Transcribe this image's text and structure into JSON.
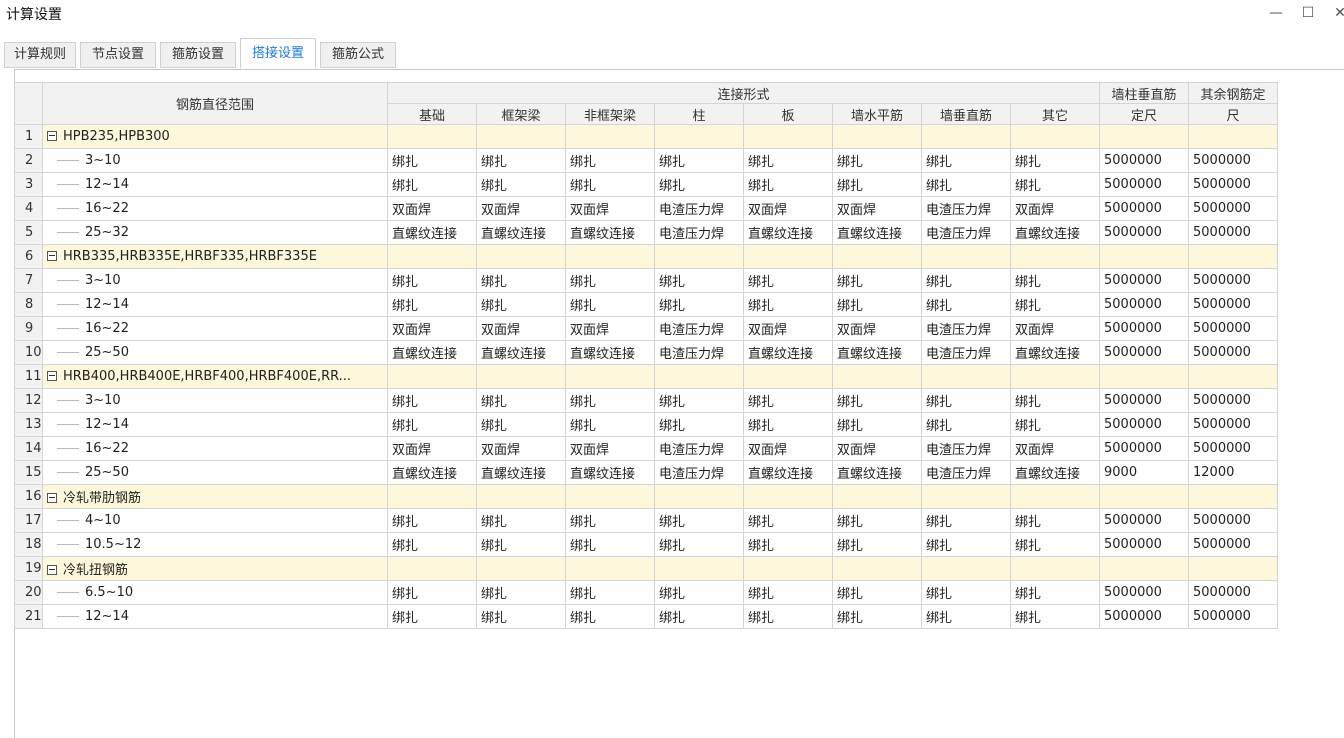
{
  "window": {
    "title": "计算设置",
    "minimize": "—",
    "maximize": "☐",
    "close": "✕"
  },
  "tabs": [
    {
      "label": "计算规则"
    },
    {
      "label": "节点设置"
    },
    {
      "label": "箍筋设置"
    },
    {
      "label": "搭接设置"
    },
    {
      "label": "箍筋公式"
    }
  ],
  "active_tab": "搭接设置",
  "table": {
    "header": {
      "range": "钢筋直径范围",
      "connection_group": "连接形式",
      "columns": [
        "基础",
        "框架梁",
        "非框架梁",
        "柱",
        "板",
        "墙水平筋",
        "墙垂直筋",
        "其它"
      ],
      "wall_col_length": [
        "墙柱垂直筋",
        "定尺"
      ],
      "other_length": [
        "其余钢筋定",
        "尺"
      ]
    },
    "rows": [
      {
        "num": "1",
        "group": true,
        "label": "HPB235,HPB300"
      },
      {
        "num": "2",
        "label": "3~10",
        "cells": [
          "绑扎",
          "绑扎",
          "绑扎",
          "绑扎",
          "绑扎",
          "绑扎",
          "绑扎",
          "绑扎",
          "5000000",
          "5000000"
        ]
      },
      {
        "num": "3",
        "label": "12~14",
        "cells": [
          "绑扎",
          "绑扎",
          "绑扎",
          "绑扎",
          "绑扎",
          "绑扎",
          "绑扎",
          "绑扎",
          "5000000",
          "5000000"
        ]
      },
      {
        "num": "4",
        "label": "16~22",
        "cells": [
          "双面焊",
          "双面焊",
          "双面焊",
          "电渣压力焊",
          "双面焊",
          "双面焊",
          "电渣压力焊",
          "双面焊",
          "5000000",
          "5000000"
        ]
      },
      {
        "num": "5",
        "label": "25~32",
        "cells": [
          "直螺纹连接",
          "直螺纹连接",
          "直螺纹连接",
          "电渣压力焊",
          "直螺纹连接",
          "直螺纹连接",
          "电渣压力焊",
          "直螺纹连接",
          "5000000",
          "5000000"
        ]
      },
      {
        "num": "6",
        "group": true,
        "label": "HRB335,HRB335E,HRBF335,HRBF335E"
      },
      {
        "num": "7",
        "label": "3~10",
        "cells": [
          "绑扎",
          "绑扎",
          "绑扎",
          "绑扎",
          "绑扎",
          "绑扎",
          "绑扎",
          "绑扎",
          "5000000",
          "5000000"
        ]
      },
      {
        "num": "8",
        "label": "12~14",
        "cells": [
          "绑扎",
          "绑扎",
          "绑扎",
          "绑扎",
          "绑扎",
          "绑扎",
          "绑扎",
          "绑扎",
          "5000000",
          "5000000"
        ]
      },
      {
        "num": "9",
        "label": "16~22",
        "cells": [
          "双面焊",
          "双面焊",
          "双面焊",
          "电渣压力焊",
          "双面焊",
          "双面焊",
          "电渣压力焊",
          "双面焊",
          "5000000",
          "5000000"
        ]
      },
      {
        "num": "10",
        "label": "25~50",
        "cells": [
          "直螺纹连接",
          "直螺纹连接",
          "直螺纹连接",
          "电渣压力焊",
          "直螺纹连接",
          "直螺纹连接",
          "电渣压力焊",
          "直螺纹连接",
          "5000000",
          "5000000"
        ]
      },
      {
        "num": "11",
        "group": true,
        "label": "HRB400,HRB400E,HRBF400,HRBF400E,RR..."
      },
      {
        "num": "12",
        "label": "3~10",
        "cells": [
          "绑扎",
          "绑扎",
          "绑扎",
          "绑扎",
          "绑扎",
          "绑扎",
          "绑扎",
          "绑扎",
          "5000000",
          "5000000"
        ]
      },
      {
        "num": "13",
        "label": "12~14",
        "cells": [
          "绑扎",
          "绑扎",
          "绑扎",
          "绑扎",
          "绑扎",
          "绑扎",
          "绑扎",
          "绑扎",
          "5000000",
          "5000000"
        ]
      },
      {
        "num": "14",
        "label": "16~22",
        "cells": [
          "双面焊",
          "双面焊",
          "双面焊",
          "电渣压力焊",
          "双面焊",
          "双面焊",
          "电渣压力焊",
          "双面焊",
          "5000000",
          "5000000"
        ]
      },
      {
        "num": "15",
        "label": "25~50",
        "cells": [
          "直螺纹连接",
          "直螺纹连接",
          "直螺纹连接",
          "电渣压力焊",
          "直螺纹连接",
          "直螺纹连接",
          "电渣压力焊",
          "直螺纹连接",
          "9000",
          "12000"
        ]
      },
      {
        "num": "16",
        "group": true,
        "label": "冷轧带肋钢筋"
      },
      {
        "num": "17",
        "label": "4~10",
        "cells": [
          "绑扎",
          "绑扎",
          "绑扎",
          "绑扎",
          "绑扎",
          "绑扎",
          "绑扎",
          "绑扎",
          "5000000",
          "5000000"
        ]
      },
      {
        "num": "18",
        "label": "10.5~12",
        "cells": [
          "绑扎",
          "绑扎",
          "绑扎",
          "绑扎",
          "绑扎",
          "绑扎",
          "绑扎",
          "绑扎",
          "5000000",
          "5000000"
        ]
      },
      {
        "num": "19",
        "group": true,
        "label": "冷轧扭钢筋"
      },
      {
        "num": "20",
        "label": "6.5~10",
        "cells": [
          "绑扎",
          "绑扎",
          "绑扎",
          "绑扎",
          "绑扎",
          "绑扎",
          "绑扎",
          "绑扎",
          "5000000",
          "5000000"
        ]
      },
      {
        "num": "21",
        "label": "12~14",
        "cells": [
          "绑扎",
          "绑扎",
          "绑扎",
          "绑扎",
          "绑扎",
          "绑扎",
          "绑扎",
          "绑扎",
          "5000000",
          "5000000"
        ]
      }
    ]
  }
}
